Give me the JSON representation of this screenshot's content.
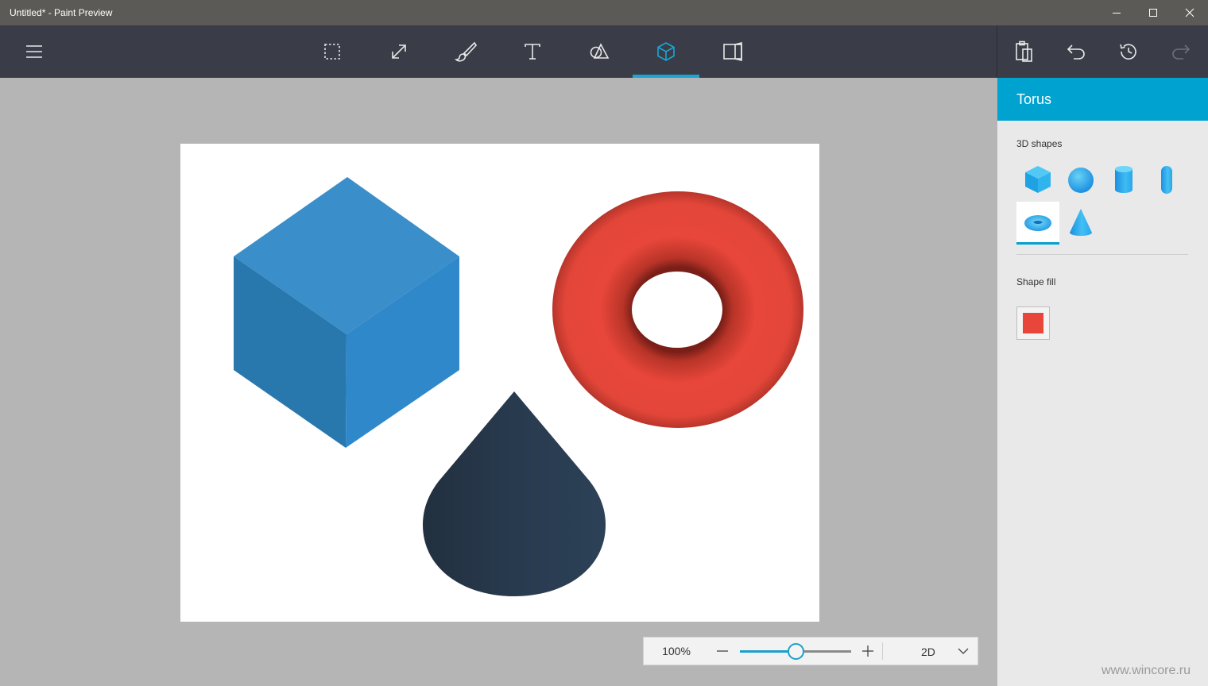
{
  "window": {
    "title": "Untitled* - Paint Preview"
  },
  "toolbar": {
    "icons": [
      "hamburger-menu-icon",
      "select-icon",
      "crop-resize-icon",
      "brush-icon",
      "text-icon",
      "2d-shapes-icon",
      "3d-objects-icon",
      "canvas-icon",
      "paste-icon",
      "undo-icon",
      "history-icon",
      "redo-icon"
    ],
    "active_tool": "3d-objects",
    "accent": "#18a7d4"
  },
  "panel": {
    "title": "Torus",
    "shapes_label": "3D shapes",
    "shapes": [
      "cube",
      "sphere",
      "cylinder",
      "capsule",
      "torus",
      "cone"
    ],
    "selected_shape": "torus",
    "fill_label": "Shape fill",
    "fill_color": "#e8463a"
  },
  "canvas_objects": [
    {
      "type": "cube",
      "color": "#3589c9"
    },
    {
      "type": "torus",
      "color": "#e8463a"
    },
    {
      "type": "cone",
      "color": "#283a4e"
    }
  ],
  "zoom": {
    "value": "100%",
    "level": 0.5,
    "mode": "2D"
  },
  "watermark": "www.wincore.ru"
}
